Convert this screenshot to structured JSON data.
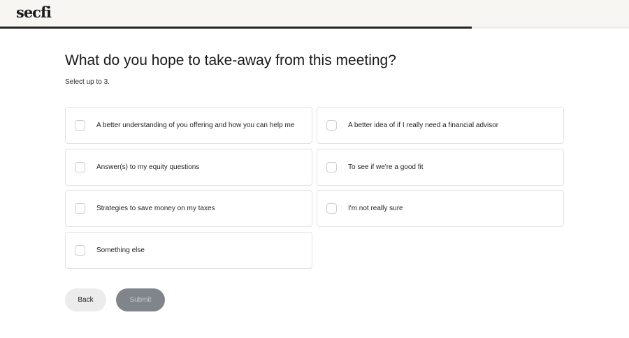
{
  "brand": {
    "logo_text": "secfi"
  },
  "progress": {
    "fraction": 0.75
  },
  "question": {
    "title": "What do you hope to take-away from this meeting?",
    "instruction": "Select up to 3."
  },
  "options": [
    {
      "label": "A better understanding of you offering and how you can help me",
      "checked": false
    },
    {
      "label": "A better idea of if I really need a financial advisor",
      "checked": false
    },
    {
      "label": "Answer(s) to my equity questions",
      "checked": false
    },
    {
      "label": "To see if we're a good fit",
      "checked": false
    },
    {
      "label": "Strategies to save money on my taxes",
      "checked": false
    },
    {
      "label": "I'm not really sure",
      "checked": false
    },
    {
      "label": "Something else",
      "checked": false
    }
  ],
  "actions": {
    "back_label": "Back",
    "submit_label": "Submit",
    "submit_enabled": false
  }
}
